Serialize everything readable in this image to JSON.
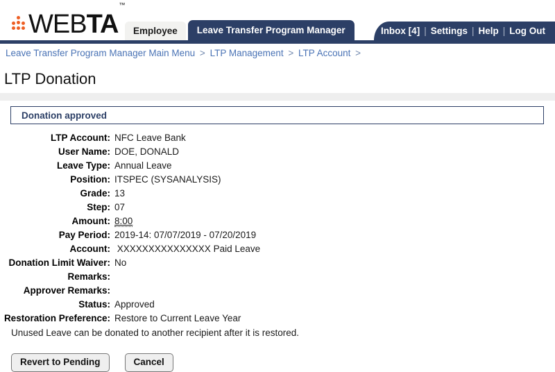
{
  "app": {
    "logo_web": "WEB",
    "logo_ta": "TA",
    "logo_tm": "™"
  },
  "tabs": [
    {
      "label": "Employee",
      "active": false
    },
    {
      "label": "Leave Transfer Program Manager",
      "active": true
    }
  ],
  "topnav": {
    "inbox": "Inbox [4]",
    "settings": "Settings",
    "help": "Help",
    "logout": "Log Out",
    "separator": "|"
  },
  "breadcrumb": {
    "items": [
      "Leave Transfer Program Manager Main Menu",
      "LTP Management",
      "LTP Account"
    ],
    "separator": ">",
    "trailing": ">"
  },
  "page": {
    "title": "LTP Donation",
    "status_message": "Donation approved"
  },
  "details": [
    {
      "label": "LTP Account:",
      "value": "NFC Leave Bank"
    },
    {
      "label": "User Name:",
      "value": "DOE, DONALD"
    },
    {
      "label": "Leave Type:",
      "value": "Annual Leave"
    },
    {
      "label": "Position:",
      "value": "ITSPEC (SYSANALYSIS)"
    },
    {
      "label": "Grade:",
      "value": "13"
    },
    {
      "label": "Step:",
      "value": "07"
    },
    {
      "label": "Amount:",
      "value": "8:00",
      "tooltip": true
    },
    {
      "label": "Pay Period:",
      "value": "2019-14: 07/07/2019 - 07/20/2019"
    },
    {
      "label": "Account:",
      "value": " XXXXXXXXXXXXXXX Paid Leave"
    },
    {
      "label": "Donation Limit Waiver:",
      "value": "No"
    },
    {
      "label": "Remarks:",
      "value": ""
    },
    {
      "label": "Approver Remarks:",
      "value": ""
    },
    {
      "label": "Status:",
      "value": "Approved"
    },
    {
      "label": "Restoration Preference:",
      "value": "Restore to Current Leave Year"
    }
  ],
  "note": "Unused Leave can be donated to another recipient after it is restored.",
  "buttons": {
    "revert": "Revert to Pending",
    "cancel": "Cancel"
  },
  "colors": {
    "navy": "#2c3f66",
    "orange": "#ee5f24",
    "link_blue": "#4a73b5",
    "band_gray": "#eeeeee",
    "button_gray": "#efefef"
  }
}
